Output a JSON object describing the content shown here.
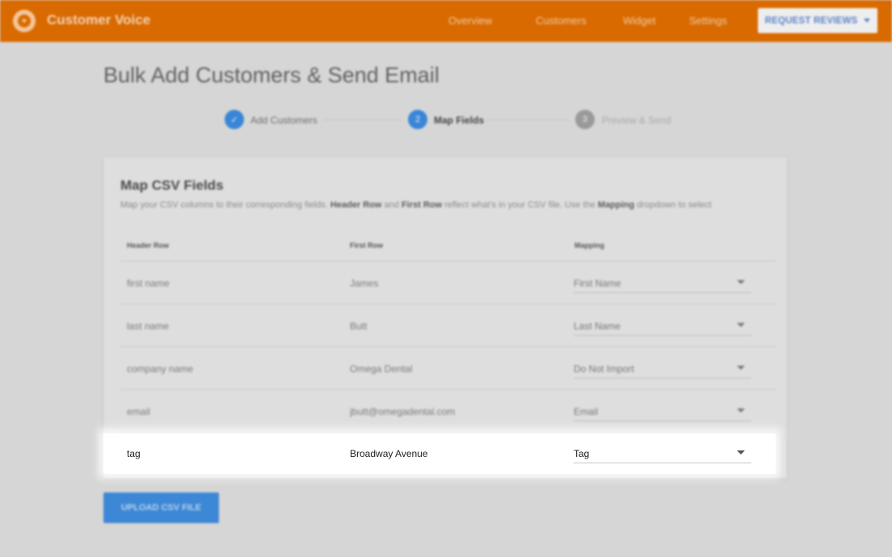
{
  "app": {
    "brand": "Customer Voice",
    "logo_icon": "heart-icon",
    "nav": [
      "Overview",
      "Customers",
      "Widget",
      "Settings"
    ],
    "request_button": "REQUEST REVIEWS"
  },
  "page": {
    "title": "Bulk Add Customers & Send Email"
  },
  "stepper": {
    "steps": [
      {
        "number": "✓",
        "label": "Add Customers",
        "state": "done"
      },
      {
        "number": "2",
        "label": "Map Fields",
        "state": "active"
      },
      {
        "number": "3",
        "label": "Preview & Send",
        "state": "inactive"
      }
    ]
  },
  "card": {
    "title": "Map CSV Fields",
    "desc_1": "Map your CSV columns to their corresponding fields.",
    "desc_bold_1": "Header Row",
    "desc_2": "and",
    "desc_bold_2": "First Row",
    "desc_3": "reflect what's in your CSV file. Use the",
    "desc_bold_3": "Mapping",
    "desc_4": "dropdown to select",
    "columns": [
      "Header Row",
      "First Row",
      "Mapping"
    ],
    "rows": [
      {
        "header": "first name",
        "first": "James",
        "mapping": "First Name"
      },
      {
        "header": "last name",
        "first": "Butt",
        "mapping": "Last Name"
      },
      {
        "header": "company name",
        "first": "Omega Dental",
        "mapping": "Do Not Import"
      },
      {
        "header": "email",
        "first": "jbutt@omegadental.com",
        "mapping": "Email"
      },
      {
        "header": "tag",
        "first": "Broadway Avenue",
        "mapping": "Tag"
      }
    ]
  },
  "upload_button": "UPLOAD CSV FILE",
  "colors": {
    "brand_orange": "#d96a00",
    "primary_blue": "#3d88d6"
  }
}
